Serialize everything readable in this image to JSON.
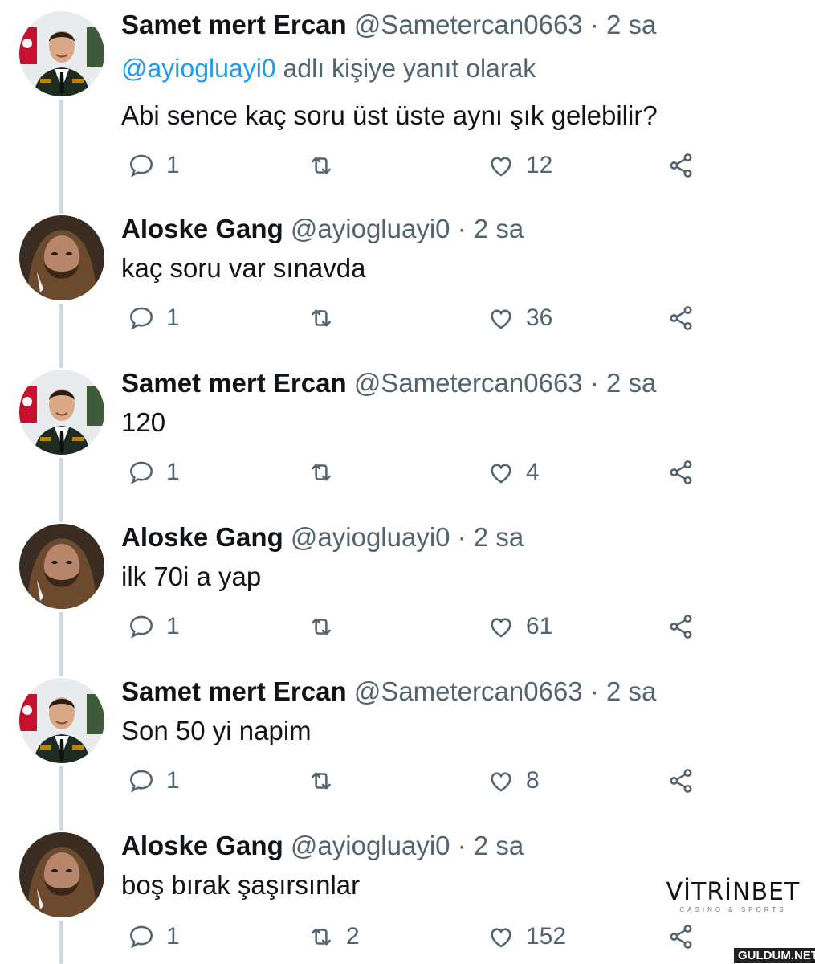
{
  "tweets": [
    {
      "name": "Samet mert Ercan",
      "handle": "@Sametercan0663",
      "dot": "·",
      "time": "2 sa",
      "reply_to_mention": "@ayiogluayi0",
      "reply_to_suffix": " adlı kişiye yanıt olarak",
      "text": "Abi sence kaç soru üst üste aynı şık gelebilir?",
      "replies": "1",
      "retweets": "",
      "likes": "12"
    },
    {
      "name": "Aloske Gang",
      "handle": "@ayiogluayi0",
      "dot": "·",
      "time": "2 sa",
      "text": "kaç soru var sınavda",
      "replies": "1",
      "retweets": "",
      "likes": "36"
    },
    {
      "name": "Samet mert Ercan",
      "handle": "@Sametercan0663",
      "dot": "·",
      "time": "2 sa",
      "text": "120",
      "replies": "1",
      "retweets": "",
      "likes": "4"
    },
    {
      "name": "Aloske Gang",
      "handle": "@ayiogluayi0",
      "dot": "·",
      "time": "2 sa",
      "text": "ilk 70i a yap",
      "replies": "1",
      "retweets": "",
      "likes": "61"
    },
    {
      "name": "Samet mert Ercan",
      "handle": "@Sametercan0663",
      "dot": "·",
      "time": "2 sa",
      "text": "Son 50 yi napim",
      "replies": "1",
      "retweets": "",
      "likes": "8"
    },
    {
      "name": "Aloske Gang",
      "handle": "@ayiogluayi0",
      "dot": "·",
      "time": "2 sa",
      "text": "boş bırak şaşırsınlar",
      "replies": "1",
      "retweets": "2",
      "likes": "152"
    }
  ],
  "icons": {
    "reply": "reply-icon",
    "retweet": "retweet-icon",
    "like": "like-icon",
    "share": "share-icon"
  },
  "colors": {
    "text": "#0f1419",
    "secondary": "#536471",
    "mention": "#1d9bf0",
    "thread_line": "#cfd9de"
  },
  "watermark": {
    "brand": "VİTRİNBET",
    "tagline": "CASINO & SPORTS",
    "site": "GULDUM.NET"
  }
}
